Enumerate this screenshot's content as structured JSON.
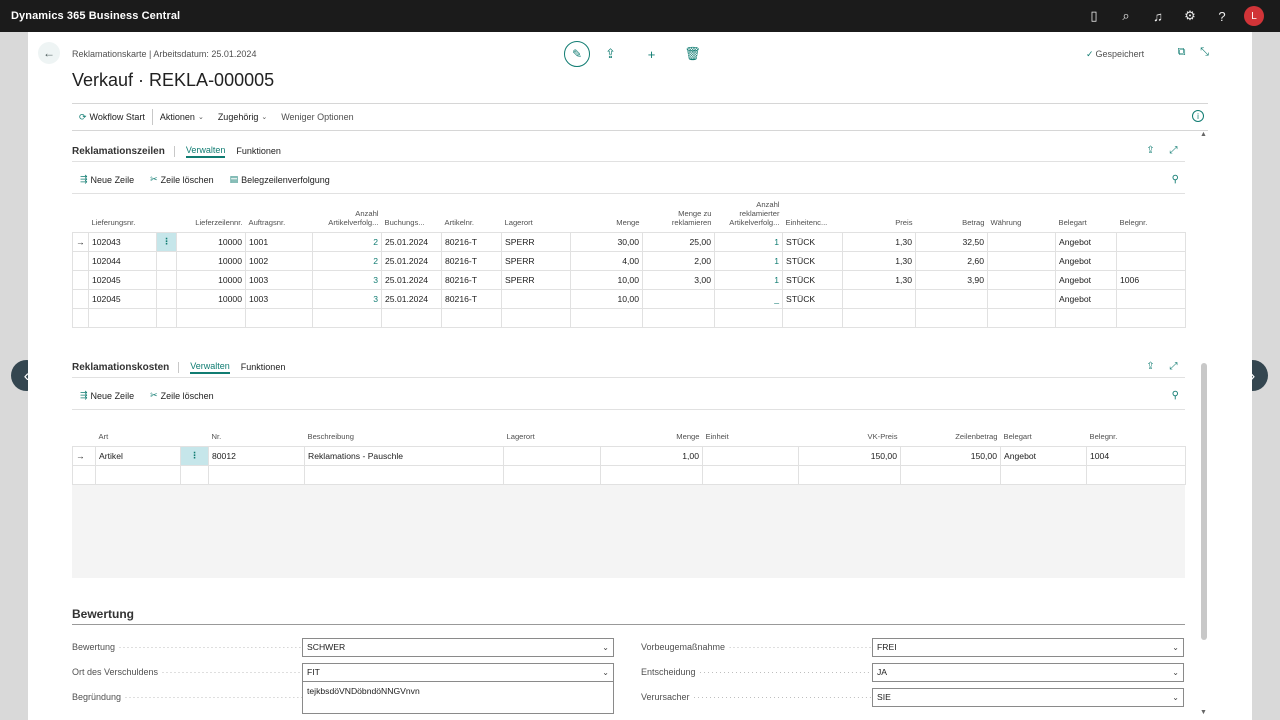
{
  "app": {
    "title": "Dynamics 365 Business Central"
  },
  "topbar_icons": [
    "document-icon",
    "search-icon",
    "bell-icon",
    "gear-icon",
    "help-icon"
  ],
  "user": {
    "initial": "L"
  },
  "page": {
    "breadcrumb": "Reklamationskarte | Arbeitsdatum: 25.01.2024",
    "title": "Verkauf · REKLA-000005",
    "status": "Gespeichert"
  },
  "actions": {
    "workflow": "Wokflow Start",
    "aktionen": "Aktionen",
    "zugehoerig": "Zugehörig",
    "weniger": "Weniger Optionen"
  },
  "lines": {
    "name": "Reklamationszeilen",
    "tab_manage": "Verwalten",
    "tab_functions": "Funktionen",
    "new_line": "Neue Zeile",
    "delete_line": "Zeile löschen",
    "tracking": "Belegzeilenverfolgung",
    "columns": [
      "Lieferungsnr.",
      "Lieferzeilennr.",
      "Auftragsnr.",
      "Anzahl Artikelverfolg...",
      "Buchungs...",
      "Artikelnr.",
      "Lagerort",
      "Menge",
      "Menge zu reklamieren",
      "Anzahl reklamierter Artikelverfolg...",
      "Einheitenc...",
      "Preis",
      "Betrag",
      "Währung",
      "Belegart",
      "Belegnr."
    ],
    "rows": [
      {
        "lief": "102043",
        "zeile": "10000",
        "auftrag": "1001",
        "anz": "2",
        "datum": "25.01.2024",
        "artikel": "80216-T",
        "lager": "SPERR",
        "menge": "30,00",
        "mzr": "25,00",
        "anzrek": "1",
        "einheit": "STÜCK",
        "preis": "1,30",
        "betrag": "32,50",
        "waehrung": "",
        "belegart": "Angebot",
        "belegnr": ""
      },
      {
        "lief": "102044",
        "zeile": "10000",
        "auftrag": "1002",
        "anz": "2",
        "datum": "25.01.2024",
        "artikel": "80216-T",
        "lager": "SPERR",
        "menge": "4,00",
        "mzr": "2,00",
        "anzrek": "1",
        "einheit": "STÜCK",
        "preis": "1,30",
        "betrag": "2,60",
        "waehrung": "",
        "belegart": "Angebot",
        "belegnr": ""
      },
      {
        "lief": "102045",
        "zeile": "10000",
        "auftrag": "1003",
        "anz": "3",
        "datum": "25.01.2024",
        "artikel": "80216-T",
        "lager": "SPERR",
        "menge": "10,00",
        "mzr": "3,00",
        "anzrek": "1",
        "einheit": "STÜCK",
        "preis": "1,30",
        "betrag": "3,90",
        "waehrung": "",
        "belegart": "Angebot",
        "belegnr": "1006"
      },
      {
        "lief": "102045",
        "zeile": "10000",
        "auftrag": "1003",
        "anz": "3",
        "datum": "25.01.2024",
        "artikel": "80216-T",
        "lager": "",
        "menge": "10,00",
        "mzr": "",
        "anzrek": "_",
        "einheit": "STÜCK",
        "preis": "",
        "betrag": "",
        "waehrung": "",
        "belegart": "Angebot",
        "belegnr": ""
      }
    ]
  },
  "costs": {
    "name": "Reklamationskosten",
    "tab_manage": "Verwalten",
    "tab_functions": "Funktionen",
    "new_line": "Neue Zeile",
    "delete_line": "Zeile löschen",
    "columns": [
      "Art",
      "Nr.",
      "Beschreibung",
      "Lagerort",
      "Menge",
      "Einheit",
      "VK-Preis",
      "Zeilenbetrag",
      "Belegart",
      "Belegnr."
    ],
    "rows": [
      {
        "art": "Artikel",
        "nr": "80012",
        "beschreibung": "Reklamations - Pauschle",
        "lager": "",
        "menge": "1,00",
        "einheit": "",
        "vkpreis": "150,00",
        "zeilenbetrag": "150,00",
        "belegart": "Angebot",
        "belegnr": "1004"
      }
    ]
  },
  "bewertung": {
    "title": "Bewertung",
    "fields": [
      {
        "label": "Bewertung",
        "value": "SCHWER"
      },
      {
        "label": "Ort des Verschuldens",
        "value": "FIT"
      },
      {
        "label": "Begründung",
        "value": "tejkbsdöVNDöbndöNNGVnvn"
      },
      {
        "label": "Vorbeugemaßnahme",
        "value": "FREI"
      },
      {
        "label": "Entscheidung",
        "value": "JA"
      },
      {
        "label": "Verursacher",
        "value": "SIE"
      }
    ]
  }
}
